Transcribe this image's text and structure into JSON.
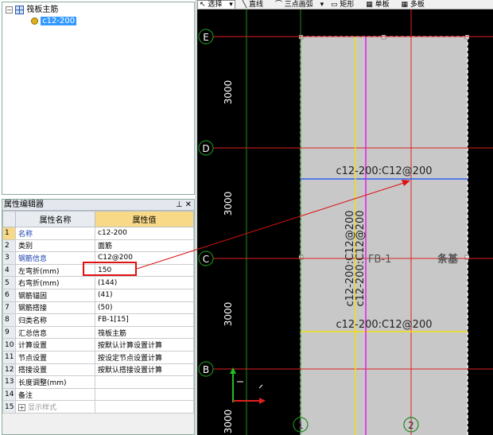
{
  "tree": {
    "root_label": "筏板主筋",
    "child_label": "c12-200"
  },
  "property_editor": {
    "title": "属性编辑器",
    "col_name": "属性名称",
    "col_value": "属性值",
    "rows": [
      {
        "num": "1",
        "name": "名称",
        "value": "c12-200"
      },
      {
        "num": "2",
        "name": "类别",
        "value": "面筋"
      },
      {
        "num": "3",
        "name": "钢筋信息",
        "value": "C12@200"
      },
      {
        "num": "4",
        "name": "左弯折(mm)",
        "value": "150"
      },
      {
        "num": "5",
        "name": "右弯折(mm)",
        "value": "(144)"
      },
      {
        "num": "6",
        "name": "钢筋锚固",
        "value": "(41)"
      },
      {
        "num": "7",
        "name": "钢筋搭接",
        "value": "(50)"
      },
      {
        "num": "8",
        "name": "归类名称",
        "value": "FB-1[15]"
      },
      {
        "num": "9",
        "name": "汇总信息",
        "value": "筏板主筋"
      },
      {
        "num": "10",
        "name": "计算设置",
        "value": "按默认计算设置计算"
      },
      {
        "num": "11",
        "name": "节点设置",
        "value": "按设定节点设置计算"
      },
      {
        "num": "12",
        "name": "搭接设置",
        "value": "按默认搭接设置计算"
      },
      {
        "num": "13",
        "name": "长度调整(mm)",
        "value": ""
      },
      {
        "num": "14",
        "name": "备注",
        "value": ""
      },
      {
        "num": "15",
        "name": "显示样式",
        "value": ""
      }
    ]
  },
  "toolbar": {
    "select": "选择",
    "line": "直线",
    "arc": "三点画弧",
    "rect": "矩形",
    "single": "单板",
    "multi": "多板"
  },
  "canvas": {
    "axis_e": "E",
    "axis_d": "D",
    "axis_c": "C",
    "axis_b": "B",
    "axis_1": "1",
    "axis_2": "2",
    "dim_ed": "3000",
    "dim_dc": "3000",
    "dim_cb": "3000",
    "dim_b_below": "3000",
    "label_top_rebar": "c12-200:C12@200",
    "label_bottom_rebar": "c12-200:C12@200",
    "label_vertical_1": "c12-200:C12@200",
    "label_vertical_2": "c12-200:C12@200",
    "label_fb": "FB-1",
    "label_tiaoji": "条基"
  },
  "colors": {
    "slab_fill": "#c8c8c8",
    "axis_red": "#e02020",
    "axis_green": "#1f8a1f",
    "rebar_blue": "#3060f0",
    "rebar_yellow": "#f0e010",
    "rebar_magenta": "#e020e0"
  }
}
